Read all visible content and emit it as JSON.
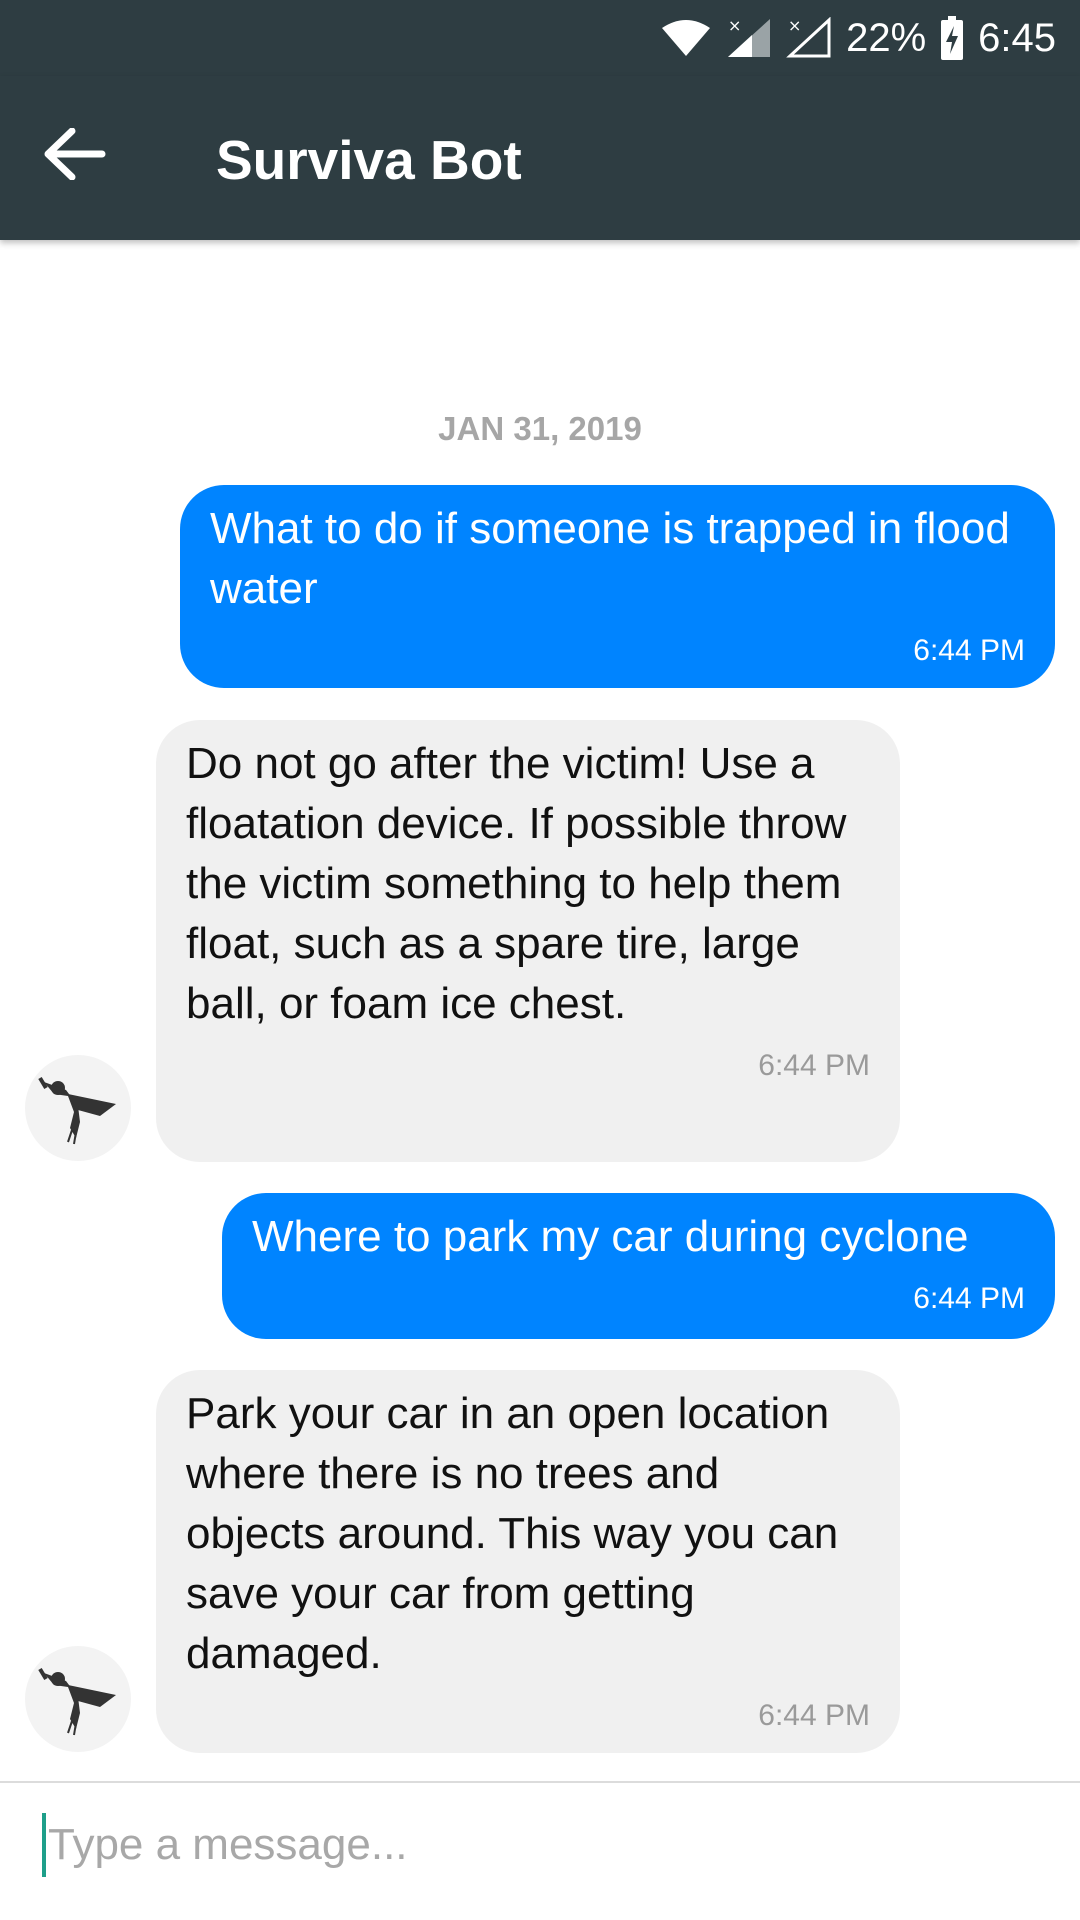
{
  "status_bar": {
    "battery": "22%",
    "time": "6:45"
  },
  "header": {
    "title": "Surviva Bot"
  },
  "chat": {
    "date_separator": "JAN 31, 2019",
    "messages": [
      {
        "direction": "outgoing",
        "text": "What to do if someone is trapped in flood water",
        "time": "6:44 PM"
      },
      {
        "direction": "incoming",
        "text": "Do not go after the victim! Use a floatation device. If possible throw the victim something to help them float, such as a spare tire, large ball, or foam ice chest.",
        "time": "6:44 PM"
      },
      {
        "direction": "outgoing",
        "text": "Where to park my car during cyclone",
        "time": "6:44 PM"
      },
      {
        "direction": "incoming",
        "text": "Park your car in an open location where there is no trees and objects around. This way you can save your car from getting damaged.",
        "time": "6:44 PM"
      }
    ]
  },
  "composer": {
    "placeholder": "Type a message..."
  },
  "colors": {
    "toolbar": "#2e3d42",
    "outgoing_bubble": "#0084ff",
    "incoming_bubble": "#f0f0f0",
    "cursor": "#1e9f8a"
  },
  "icons": {
    "back": "arrow-left-icon",
    "wifi": "wifi-icon",
    "signal": "signal-icon",
    "battery": "battery-charging-icon",
    "bot_avatar": "superhero-icon"
  }
}
